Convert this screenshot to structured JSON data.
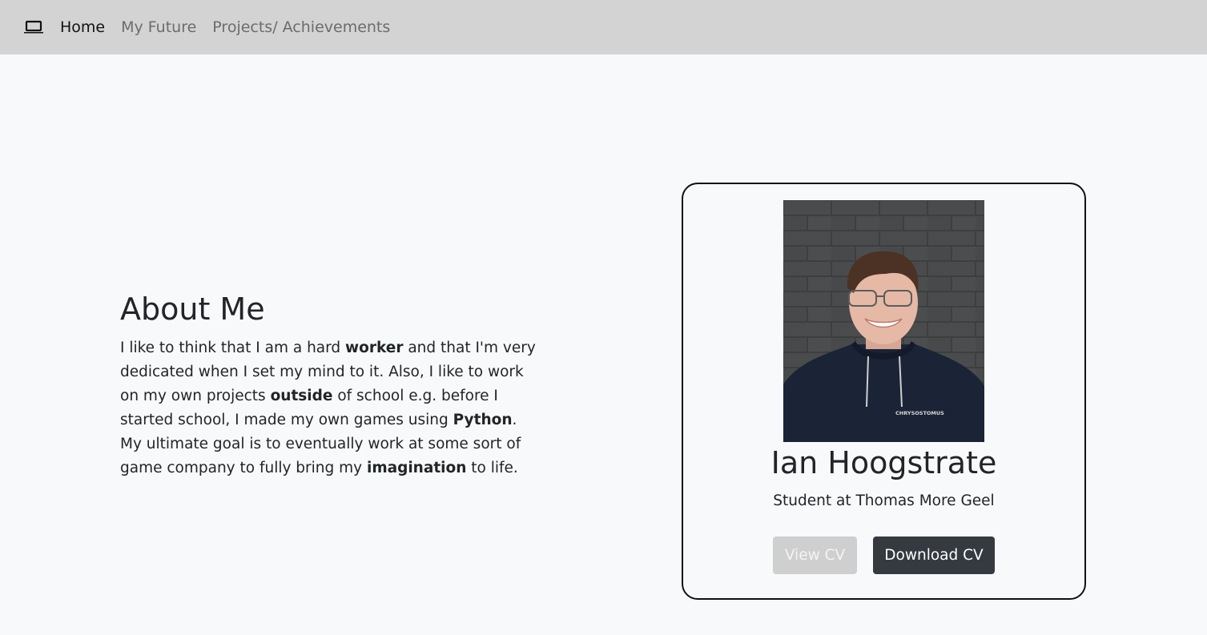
{
  "nav": {
    "brand_icon": "laptop-icon",
    "links": [
      "Home",
      "My Future",
      "Projects/ Achievements"
    ],
    "active_index": 0
  },
  "about": {
    "heading": "About Me",
    "text_parts": [
      {
        "text": "I like to think that I am a hard ",
        "bold": false
      },
      {
        "text": "worker",
        "bold": true
      },
      {
        "text": " and that I'm very dedicated when I set my mind to it. Also, I like to work on my own projects ",
        "bold": false
      },
      {
        "text": "outside",
        "bold": true
      },
      {
        "text": " of school e.g. before I started school, I made my own games using ",
        "bold": false
      },
      {
        "text": "Python",
        "bold": true
      },
      {
        "text": ". My ultimate goal is to eventually work at some sort of game company to fully bring my ",
        "bold": false
      },
      {
        "text": "imagination",
        "bold": true
      },
      {
        "text": " to life.",
        "bold": false
      }
    ]
  },
  "profile": {
    "photo_icon": "profile-photo",
    "photo_print": "CHRYSOSTOMUS",
    "name": "Ian Hoogstrate",
    "subtitle": "Student at Thomas More Geel",
    "view_label": "View CV",
    "download_label": "Download CV"
  },
  "colors": {
    "navbar_bg": "#d3d3d3",
    "page_bg": "#f8f9fa",
    "button_dark": "#343a40",
    "button_disabled": "#cfcfcf"
  }
}
